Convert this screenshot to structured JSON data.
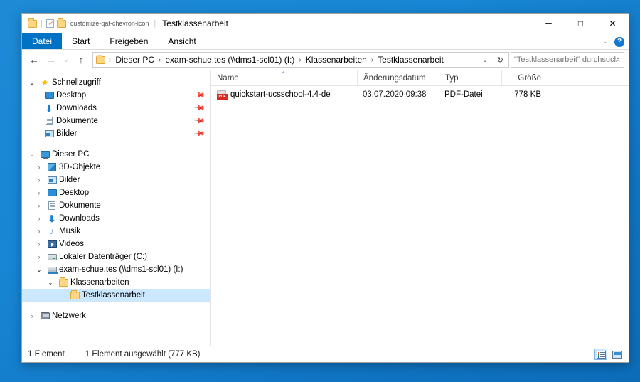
{
  "window": {
    "title": "Testklassenarbeit",
    "quick_access_icons": [
      "folder-icon",
      "properties-icon",
      "new-folder-icon",
      "customize-qat-chevron-icon"
    ],
    "controls": {
      "minimize": "─",
      "maximize": "□",
      "close": "✕"
    }
  },
  "ribbon": {
    "tabs": [
      {
        "label": "Datei",
        "active": true
      },
      {
        "label": "Start",
        "active": false
      },
      {
        "label": "Freigeben",
        "active": false
      },
      {
        "label": "Ansicht",
        "active": false
      }
    ],
    "collapse_chevron": "⌄",
    "help_label": "?"
  },
  "address_bar": {
    "back": "←",
    "forward": "→",
    "recent_chevron": "⌄",
    "up": "↑",
    "breadcrumbs": [
      "Dieser PC",
      "exam-schue.tes (\\\\dms1-scl01) (I:)",
      "Klassenarbeiten",
      "Testklassenarbeit"
    ],
    "separator": "›",
    "dropdown_chevron": "⌄",
    "refresh": "↻"
  },
  "search": {
    "placeholder": "\"Testklassenarbeit\" durchsuch...",
    "icon": "⌕"
  },
  "nav_pane": {
    "groups": [
      {
        "name": "Schnellzugriff",
        "twisty": "⌄",
        "icon": "star-icon",
        "level": 0,
        "items": [
          {
            "label": "Desktop",
            "icon": "monitor-icon",
            "pinned": true,
            "level": 1
          },
          {
            "label": "Downloads",
            "icon": "download-arrow-icon",
            "pinned": true,
            "level": 1
          },
          {
            "label": "Dokumente",
            "icon": "document-icon",
            "pinned": true,
            "level": 1
          },
          {
            "label": "Bilder",
            "icon": "picture-icon",
            "pinned": true,
            "level": 1
          }
        ]
      },
      {
        "name": "Dieser PC",
        "twisty": "⌄",
        "icon": "this-pc-icon",
        "level": 0,
        "items": [
          {
            "label": "3D-Objekte",
            "icon": "3d-objects-icon",
            "twisty": "›",
            "level": 1
          },
          {
            "label": "Bilder",
            "icon": "picture-icon",
            "twisty": "›",
            "level": 1
          },
          {
            "label": "Desktop",
            "icon": "monitor-icon",
            "twisty": "›",
            "level": 1
          },
          {
            "label": "Dokumente",
            "icon": "document-icon",
            "twisty": "›",
            "level": 1
          },
          {
            "label": "Downloads",
            "icon": "download-arrow-icon",
            "twisty": "›",
            "level": 1
          },
          {
            "label": "Musik",
            "icon": "music-note-icon",
            "twisty": "›",
            "level": 1
          },
          {
            "label": "Videos",
            "icon": "video-icon",
            "twisty": "›",
            "level": 1
          },
          {
            "label": "Lokaler Datenträger (C:)",
            "icon": "hard-drive-icon",
            "twisty": "›",
            "level": 1
          },
          {
            "label": "exam-schue.tes (\\\\dms1-scl01) (I:)",
            "icon": "network-drive-icon",
            "twisty": "⌄",
            "expanded": true,
            "level": 1
          },
          {
            "label": "Klassenarbeiten",
            "icon": "folder-icon",
            "twisty": "⌄",
            "expanded": true,
            "level": 2
          },
          {
            "label": "Testklassenarbeit",
            "icon": "folder-icon",
            "selected": true,
            "level": 3
          }
        ]
      },
      {
        "name": "Netzwerk",
        "twisty": "›",
        "icon": "network-icon",
        "level": 0,
        "items": []
      }
    ]
  },
  "file_list": {
    "columns": [
      {
        "key": "name",
        "label": "Name",
        "sorted": "asc",
        "sort_glyph": "⌃"
      },
      {
        "key": "date",
        "label": "Änderungsdatum"
      },
      {
        "key": "type",
        "label": "Typ"
      },
      {
        "key": "size",
        "label": "Größe"
      }
    ],
    "rows": [
      {
        "name": "quickstart-ucsschool-4.4-de",
        "date": "03.07.2020 09:38",
        "type": "PDF-Datei",
        "size": "778 KB",
        "icon": "pdf-file-icon"
      }
    ]
  },
  "status_bar": {
    "item_count": "1 Element",
    "selection": "1 Element ausgewählt (777 KB)",
    "views": [
      {
        "name": "details-view",
        "active": true
      },
      {
        "name": "large-icons-view",
        "active": false
      }
    ]
  },
  "colors": {
    "accent": "#0072c6",
    "selection": "#cce8ff",
    "hover": "#e5f3fb",
    "desktop": "#1e8ad6",
    "pdf_red": "#d42a21"
  }
}
